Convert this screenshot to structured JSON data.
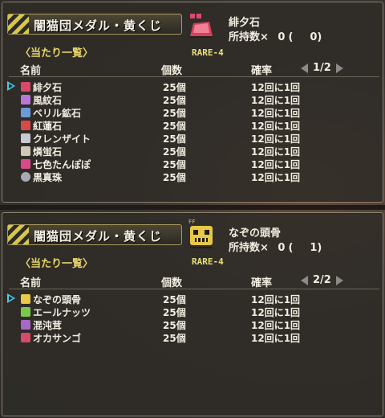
{
  "colors": {
    "accent_yellow": "#e6d36a",
    "cursor": "#4cc8e8",
    "rare": "#e8e07a"
  },
  "panels": [
    {
      "banner": "闇猫団メダル・黄くじ",
      "list_heading": "〈当たり一覧〉",
      "item": {
        "name": "緋夕石",
        "owned_label": "所持数×",
        "owned_count": "0",
        "paren_open": "(",
        "paren_value": "0)",
        "rarity": "RARE-4",
        "icon": "red-stone-icon"
      },
      "headers": {
        "name": "名前",
        "qty": "個数",
        "rate": "確率"
      },
      "page": "1/2",
      "rows": [
        {
          "name": "緋夕石",
          "qty": "25個",
          "rate": "12回に1回",
          "icon": "red-ore",
          "color": "#d84a6a"
        },
        {
          "name": "風紋石",
          "qty": "25個",
          "rate": "12回に1回",
          "icon": "purple-ore",
          "color": "#b878d8"
        },
        {
          "name": "ベリル鉱石",
          "qty": "25個",
          "rate": "12回に1回",
          "icon": "blue-ore",
          "color": "#6a9ad8"
        },
        {
          "name": "紅蓮石",
          "qty": "25個",
          "rate": "12回に1回",
          "icon": "red-ore",
          "color": "#d84a4a"
        },
        {
          "name": "クレンザイト",
          "qty": "25個",
          "rate": "12回に1回",
          "icon": "gray-ore",
          "color": "#c8c8d0"
        },
        {
          "name": "燐蛍石",
          "qty": "25個",
          "rate": "12回に1回",
          "icon": "gray-ore",
          "color": "#d0c8b8"
        },
        {
          "name": "七色たんぽぽ",
          "qty": "25個",
          "rate": "12回に1回",
          "icon": "herb",
          "color": "#d84a8a"
        },
        {
          "name": "黒真珠",
          "qty": "25個",
          "rate": "12回に1回",
          "icon": "pearl",
          "color": "#a8a8b0"
        }
      ]
    },
    {
      "banner": "闇猫団メダル・黄くじ",
      "list_heading": "〈当たり一覧〉",
      "item": {
        "name": "なぞの頭骨",
        "owned_label": "所持数×",
        "owned_count": "0",
        "paren_open": "(",
        "paren_value": "1)",
        "rarity": "RARE-4",
        "icon": "skull-icon",
        "icon_tag": "FF"
      },
      "headers": {
        "name": "名前",
        "qty": "個数",
        "rate": "確率"
      },
      "page": "2/2",
      "rows": [
        {
          "name": "なぞの頭骨",
          "qty": "25個",
          "rate": "12回に1回",
          "icon": "skull",
          "color": "#e8c848"
        },
        {
          "name": "エールナッツ",
          "qty": "25個",
          "rate": "12回に1回",
          "icon": "nut",
          "color": "#7ac84a"
        },
        {
          "name": "混沌茸",
          "qty": "25個",
          "rate": "12回に1回",
          "icon": "mushroom",
          "color": "#a868c8"
        },
        {
          "name": "オカサンゴ",
          "qty": "25個",
          "rate": "12回に1回",
          "icon": "coral",
          "color": "#d84a6a"
        }
      ]
    }
  ]
}
